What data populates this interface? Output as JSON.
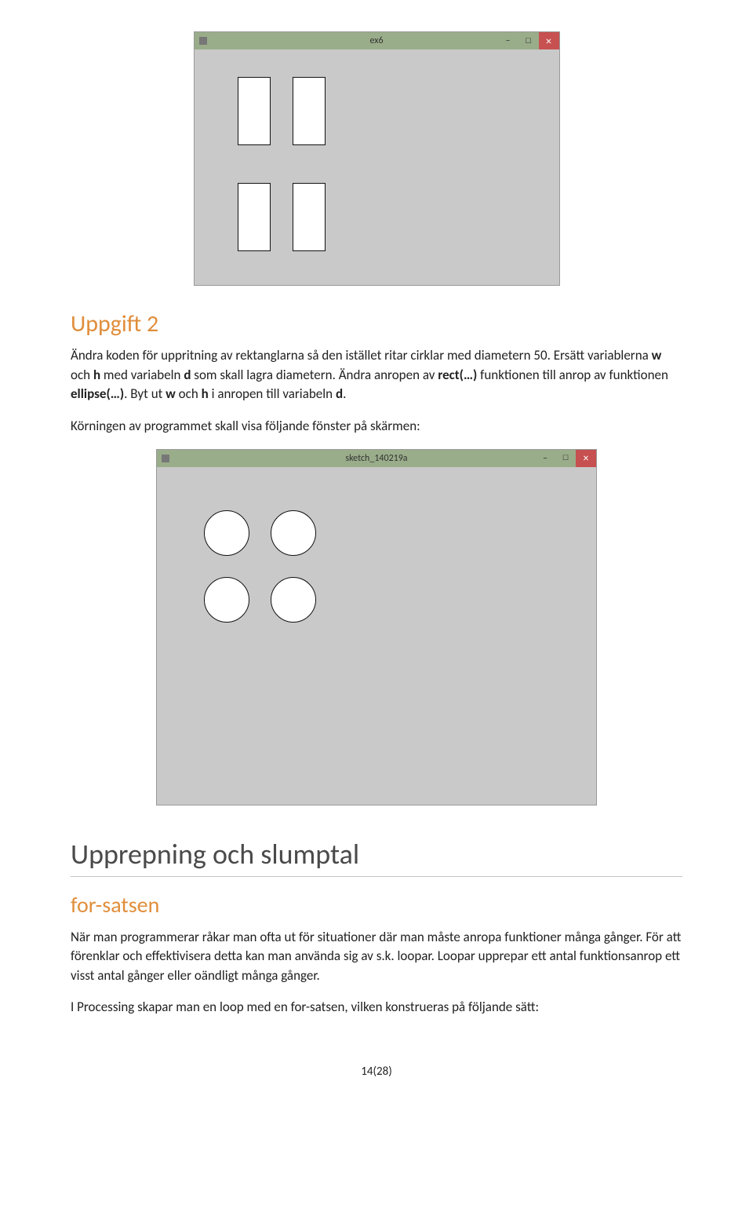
{
  "window1": {
    "title": "ex6"
  },
  "window2": {
    "title": "sketch_140219a"
  },
  "uppgift2": {
    "heading": "Uppgift 2",
    "p1_a": "Ändra koden för uppritning av rektanglarna så den istället ritar cirklar med diametern 50. Ersätt variablerna ",
    "p1_w": "w",
    "p1_b": " och ",
    "p1_h": "h",
    "p1_c": " med variabeln ",
    "p1_d": "d",
    "p1_e": " som skall lagra diametern. Ändra anropen av ",
    "p1_rect": "rect(…)",
    "p1_f": " funktionen till anrop av funktionen ",
    "p1_ellipse": "ellipse(…)",
    "p1_g": ". Byt ut ",
    "p1_w2": "w",
    "p1_h2": " och ",
    "p1_h3": "h",
    "p1_i": " i anropen till variabeln ",
    "p1_d2": "d",
    "p1_j": ".",
    "p2": "Körningen av programmet skall visa följande fönster på skärmen:"
  },
  "section2": {
    "heading": "Upprepning och slumptal",
    "subheading": "for-satsen",
    "p1": "När man programmerar råkar man ofta ut för situationer där man måste anropa funktioner många gånger. För att förenklar och effektivisera detta kan man använda sig av s.k. loopar. Loopar upprepar ett antal funktionsanrop ett visst antal gånger eller oändligt många gånger.",
    "p2": "I Processing skapar man en loop med en for-satsen, vilken konstrueras på följande sätt:"
  },
  "pagenum": "14(28)"
}
